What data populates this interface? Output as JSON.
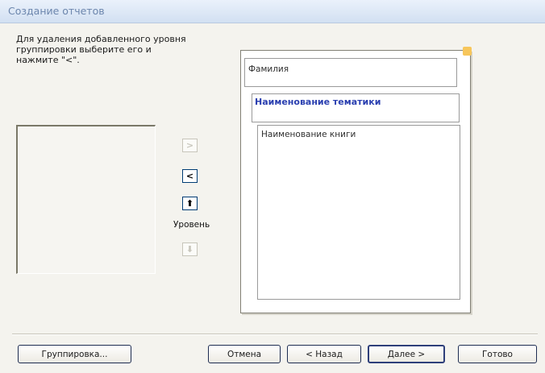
{
  "window": {
    "title": "Создание отчетов"
  },
  "instructions": "Для удаления добавленного уровня\nгруппировки выберите его и\nнажмите \"<\".",
  "level_buttons": {
    "add": ">",
    "remove": "<",
    "up": "⬆",
    "down": "⬇",
    "level_label": "Уровень"
  },
  "preview": {
    "group1": "Фамилия",
    "group2": "Наименование тематики",
    "detail": "Наименование книги"
  },
  "footer": {
    "grouping": "Группировка...",
    "cancel": "Отмена",
    "back": "< Назад",
    "next": "Далее >",
    "finish": "Готово"
  }
}
